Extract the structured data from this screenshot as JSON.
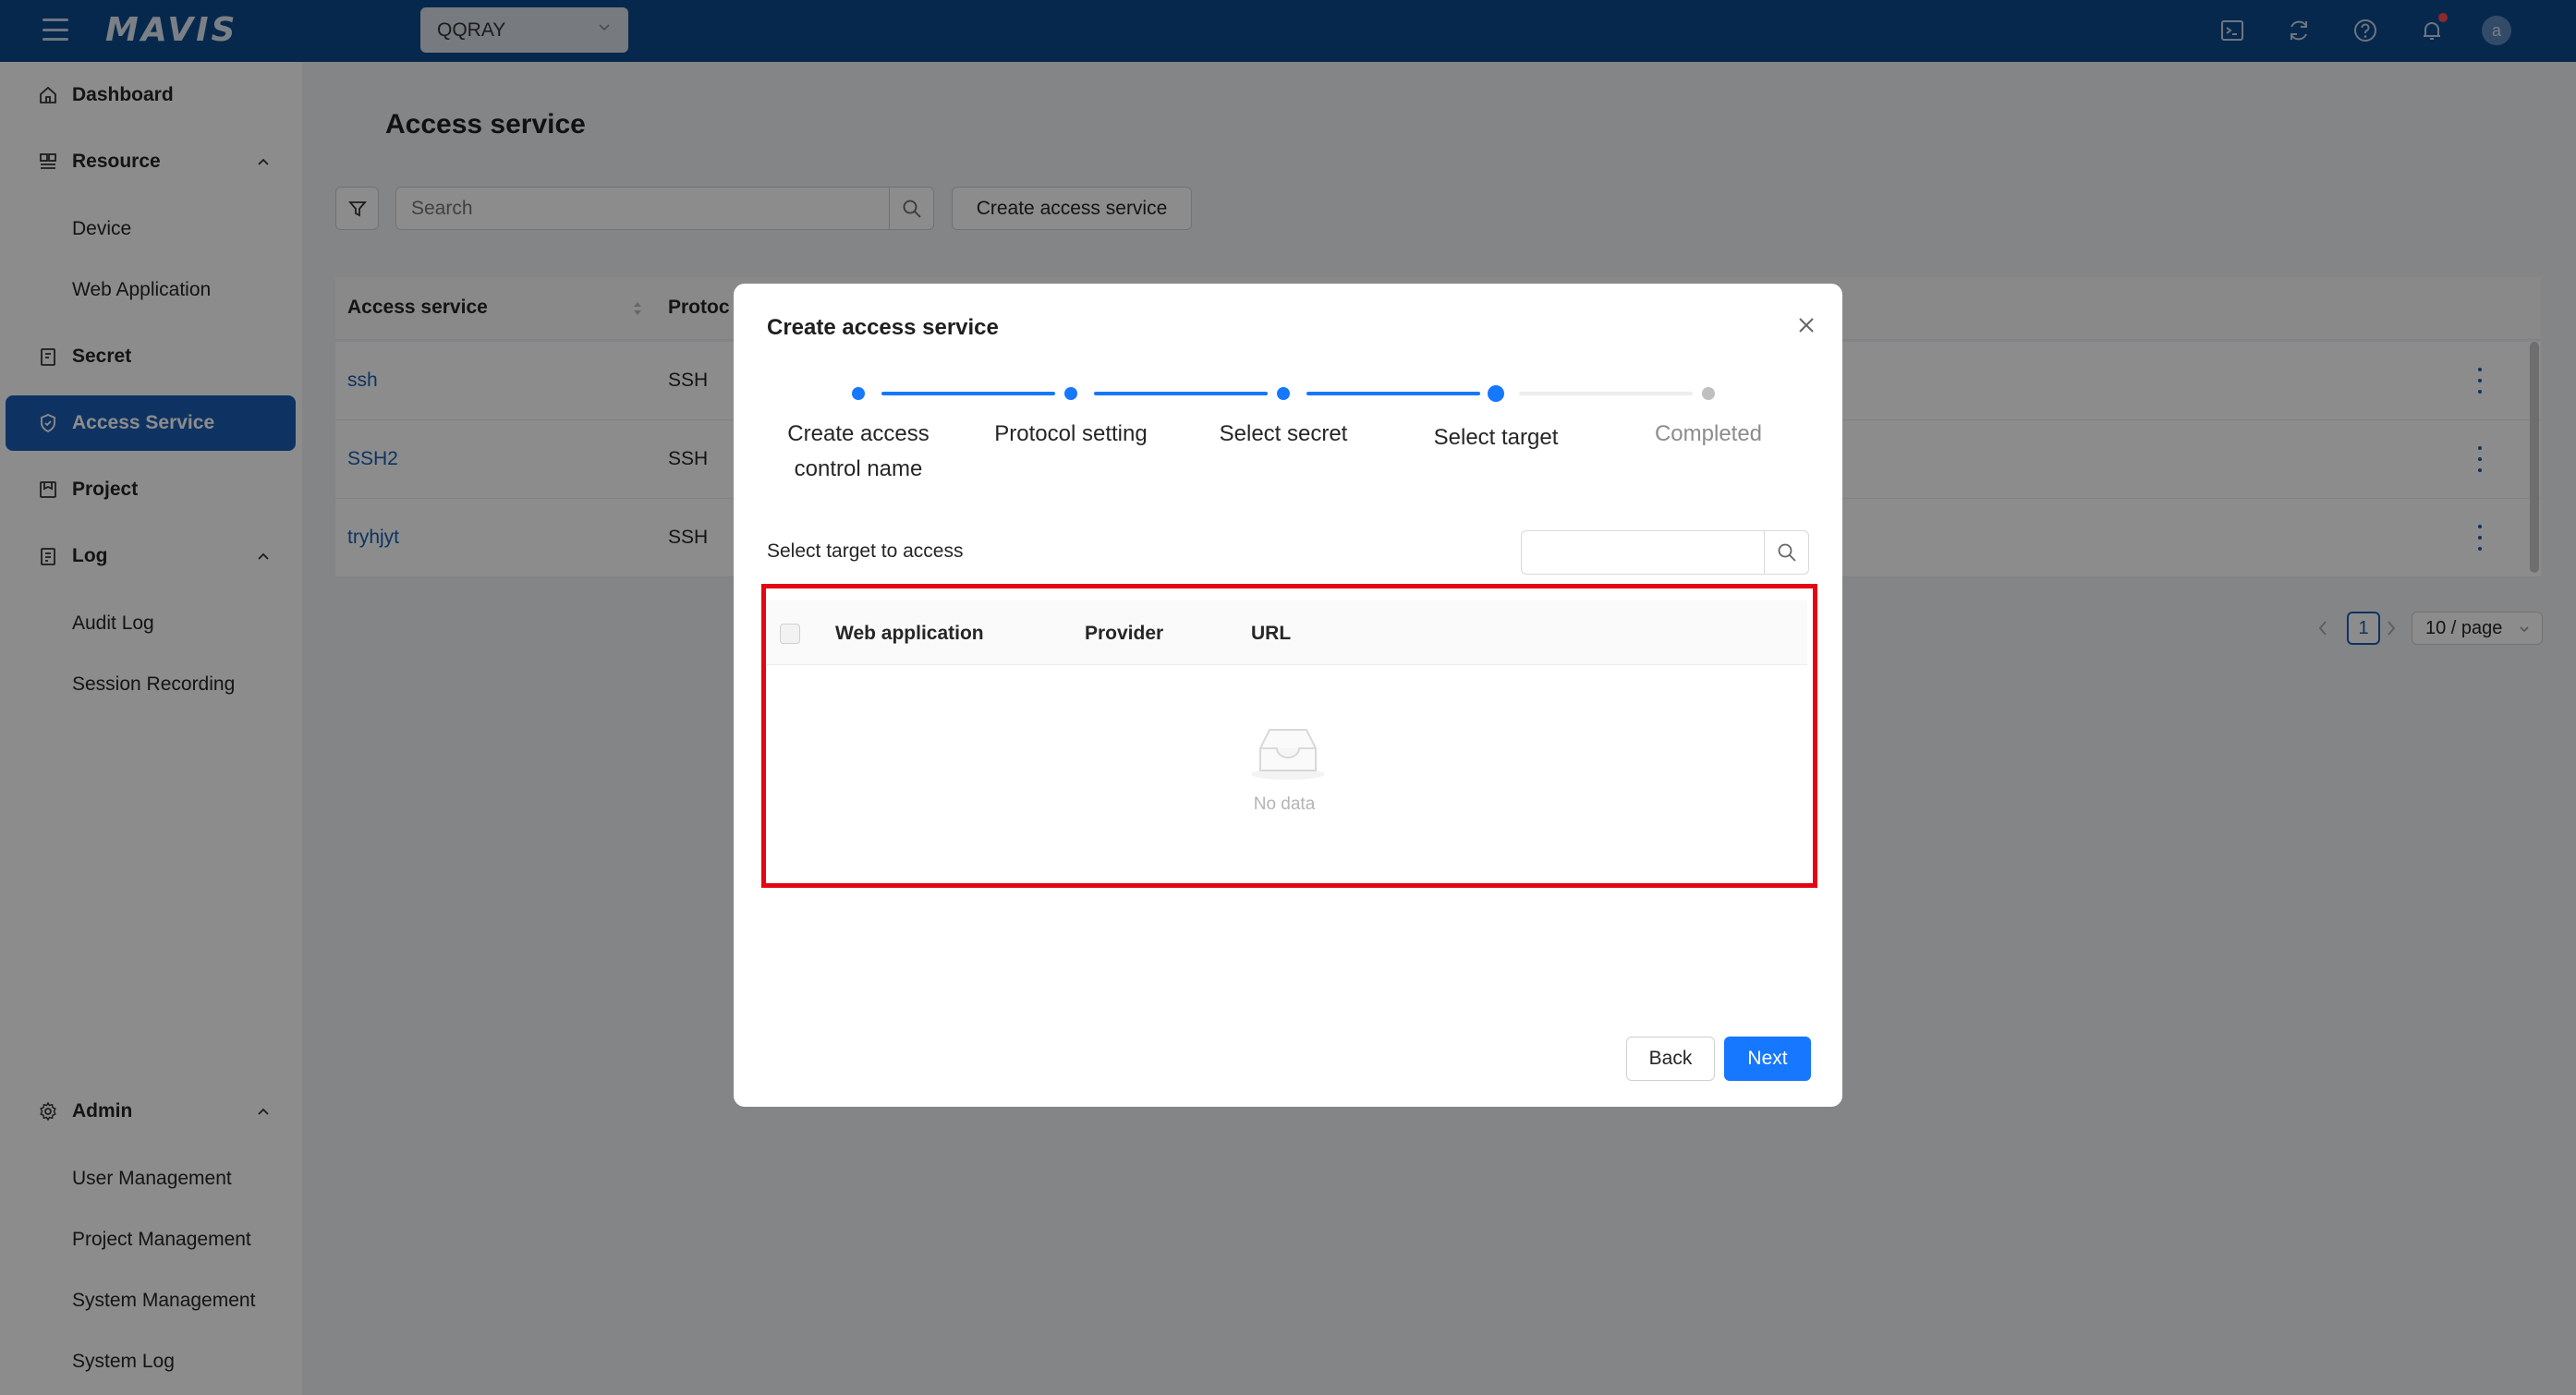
{
  "app": {
    "logo_text": "MAVIS",
    "project": "QQRAY"
  },
  "topbar": {
    "icons": [
      "terminal-icon",
      "refresh-icon",
      "help-icon",
      "bell-icon"
    ],
    "avatar_letter": "a",
    "brand_color": "#0d4a8c"
  },
  "sidebar": {
    "dashboard": "Dashboard",
    "resource": "Resource",
    "device": "Device",
    "web_application": "Web Application",
    "secret": "Secret",
    "access_service": "Access Service",
    "project": "Project",
    "log": "Log",
    "audit_log": "Audit Log",
    "session_recording": "Session Recording",
    "admin": "Admin",
    "user_management": "User Management",
    "project_management": "Project Management",
    "system_management": "System Management",
    "system_log": "System Log"
  },
  "main": {
    "title": "Access service",
    "search_placeholder": "Search",
    "create_button": "Create access service",
    "columns": {
      "access_service": "Access service",
      "protocol": "Protoc"
    },
    "rows": [
      {
        "name": "ssh",
        "protocol": "SSH"
      },
      {
        "name": "SSH2",
        "protocol": "SSH"
      },
      {
        "name": "tryhjyt",
        "protocol": "SSH"
      }
    ],
    "pagination": {
      "current_page": "1",
      "page_size": "10 / page"
    }
  },
  "modal": {
    "title": "Create access service",
    "steps": [
      {
        "label": "Create access control name",
        "status": "done"
      },
      {
        "label": "Protocol setting",
        "status": "done"
      },
      {
        "label": "Select secret",
        "status": "done"
      },
      {
        "label": "Select target",
        "status": "current"
      },
      {
        "label": "Completed",
        "status": "pending"
      }
    ],
    "section_label": "Select target to access",
    "search_value": "",
    "table_columns": {
      "web_application": "Web application",
      "provider": "Provider",
      "url": "URL"
    },
    "empty_text": "No data",
    "back_button": "Back",
    "next_button": "Next",
    "accent_color": "#1677ff",
    "highlight_color": "#e30613"
  }
}
